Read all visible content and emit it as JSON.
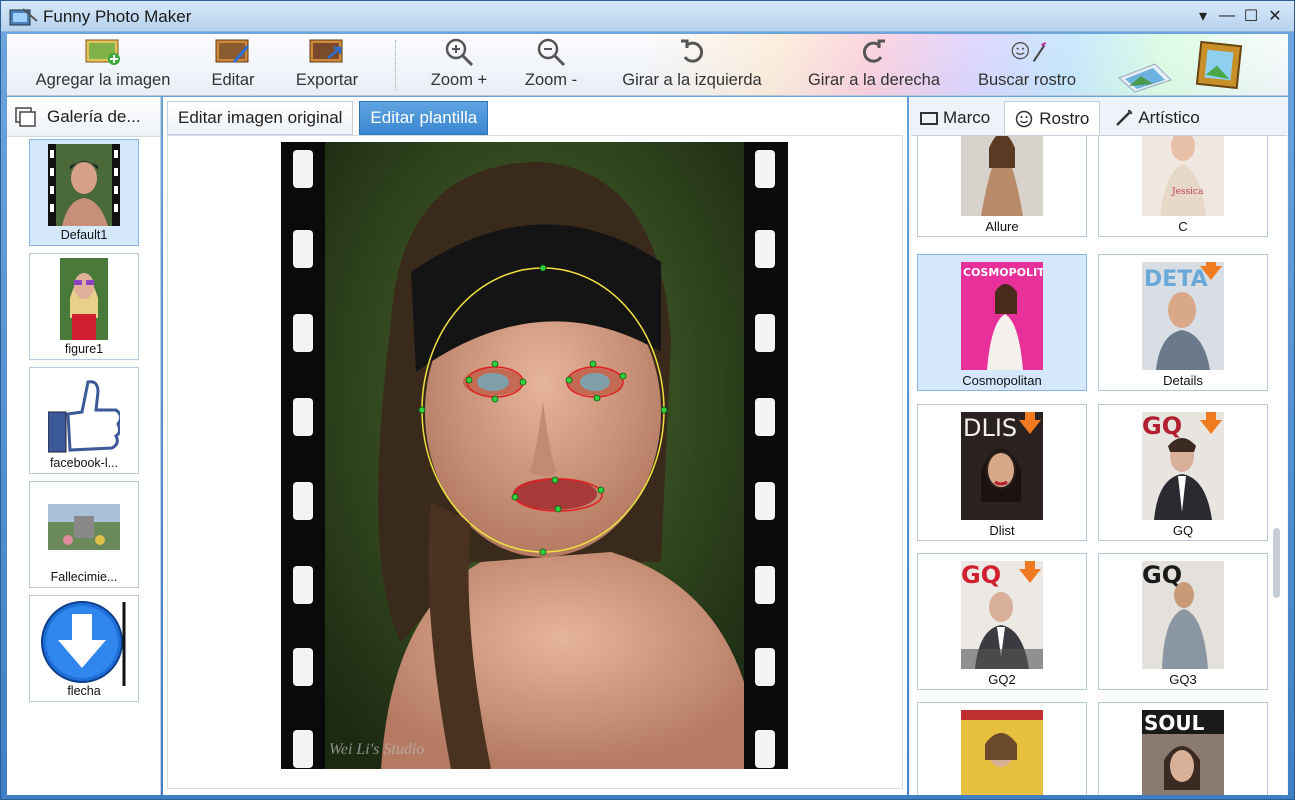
{
  "window": {
    "title": "Funny Photo Maker"
  },
  "toolbar": {
    "add_image": "Agregar la imagen",
    "edit": "Editar",
    "export": "Exportar",
    "zoom_in": "Zoom +",
    "zoom_out": "Zoom -",
    "rotate_left": "Girar a la izquierda",
    "rotate_right": "Girar a la derecha",
    "find_face": "Buscar rostro"
  },
  "gallery": {
    "title": "Galería de...",
    "items": [
      {
        "label": "Default1",
        "icon": "portrait-filmstrip-thumb"
      },
      {
        "label": "figure1",
        "icon": "portrait-sunglasses-thumb"
      },
      {
        "label": "facebook-l...",
        "icon": "thumbs-up-icon"
      },
      {
        "label": "Fallecimie...",
        "icon": "landscape-thumb"
      },
      {
        "label": "flecha",
        "icon": "download-arrow-icon"
      }
    ]
  },
  "editor": {
    "tabs": [
      "Editar imagen original",
      "Editar plantilla"
    ],
    "active_tab": "Editar plantilla",
    "watermark": "Wei Li's Studio"
  },
  "templates_panel": {
    "tabs": [
      "Marco",
      "Rostro",
      "Artístico"
    ],
    "active_tab": "Rostro",
    "items": [
      {
        "label": "Allure",
        "cover_text": ""
      },
      {
        "label": "C",
        "cover_text": ""
      },
      {
        "label": "Cosmopolitan",
        "cover_text": "COSMOPOLITAN"
      },
      {
        "label": "Details",
        "cover_text": "DETA"
      },
      {
        "label": "Dlist",
        "cover_text": "DLIS"
      },
      {
        "label": "GQ",
        "cover_text": "GQ"
      },
      {
        "label": "GQ2",
        "cover_text": "GQ"
      },
      {
        "label": "GQ3",
        "cover_text": "GQ"
      },
      {
        "label": "",
        "cover_text": ""
      },
      {
        "label": "",
        "cover_text": "SOUL"
      }
    ]
  },
  "colors": {
    "accent": "#3b87d1",
    "face_outline": "#f0e040",
    "feature_outline": "#e02020",
    "feature_points": "#30d040"
  }
}
